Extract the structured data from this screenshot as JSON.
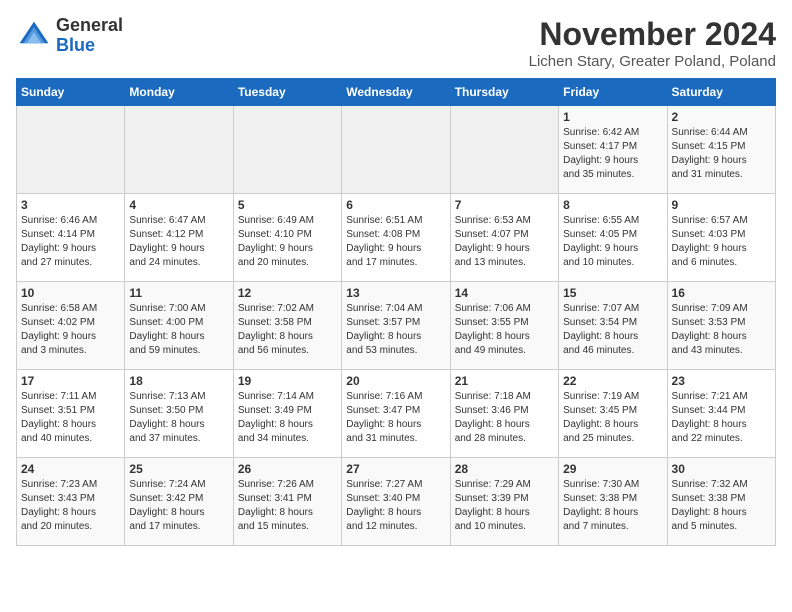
{
  "header": {
    "logo_general": "General",
    "logo_blue": "Blue",
    "title": "November 2024",
    "subtitle": "Lichen Stary, Greater Poland, Poland"
  },
  "weekdays": [
    "Sunday",
    "Monday",
    "Tuesday",
    "Wednesday",
    "Thursday",
    "Friday",
    "Saturday"
  ],
  "weeks": [
    [
      {
        "day": "",
        "info": ""
      },
      {
        "day": "",
        "info": ""
      },
      {
        "day": "",
        "info": ""
      },
      {
        "day": "",
        "info": ""
      },
      {
        "day": "",
        "info": ""
      },
      {
        "day": "1",
        "info": "Sunrise: 6:42 AM\nSunset: 4:17 PM\nDaylight: 9 hours\nand 35 minutes."
      },
      {
        "day": "2",
        "info": "Sunrise: 6:44 AM\nSunset: 4:15 PM\nDaylight: 9 hours\nand 31 minutes."
      }
    ],
    [
      {
        "day": "3",
        "info": "Sunrise: 6:46 AM\nSunset: 4:14 PM\nDaylight: 9 hours\nand 27 minutes."
      },
      {
        "day": "4",
        "info": "Sunrise: 6:47 AM\nSunset: 4:12 PM\nDaylight: 9 hours\nand 24 minutes."
      },
      {
        "day": "5",
        "info": "Sunrise: 6:49 AM\nSunset: 4:10 PM\nDaylight: 9 hours\nand 20 minutes."
      },
      {
        "day": "6",
        "info": "Sunrise: 6:51 AM\nSunset: 4:08 PM\nDaylight: 9 hours\nand 17 minutes."
      },
      {
        "day": "7",
        "info": "Sunrise: 6:53 AM\nSunset: 4:07 PM\nDaylight: 9 hours\nand 13 minutes."
      },
      {
        "day": "8",
        "info": "Sunrise: 6:55 AM\nSunset: 4:05 PM\nDaylight: 9 hours\nand 10 minutes."
      },
      {
        "day": "9",
        "info": "Sunrise: 6:57 AM\nSunset: 4:03 PM\nDaylight: 9 hours\nand 6 minutes."
      }
    ],
    [
      {
        "day": "10",
        "info": "Sunrise: 6:58 AM\nSunset: 4:02 PM\nDaylight: 9 hours\nand 3 minutes."
      },
      {
        "day": "11",
        "info": "Sunrise: 7:00 AM\nSunset: 4:00 PM\nDaylight: 8 hours\nand 59 minutes."
      },
      {
        "day": "12",
        "info": "Sunrise: 7:02 AM\nSunset: 3:58 PM\nDaylight: 8 hours\nand 56 minutes."
      },
      {
        "day": "13",
        "info": "Sunrise: 7:04 AM\nSunset: 3:57 PM\nDaylight: 8 hours\nand 53 minutes."
      },
      {
        "day": "14",
        "info": "Sunrise: 7:06 AM\nSunset: 3:55 PM\nDaylight: 8 hours\nand 49 minutes."
      },
      {
        "day": "15",
        "info": "Sunrise: 7:07 AM\nSunset: 3:54 PM\nDaylight: 8 hours\nand 46 minutes."
      },
      {
        "day": "16",
        "info": "Sunrise: 7:09 AM\nSunset: 3:53 PM\nDaylight: 8 hours\nand 43 minutes."
      }
    ],
    [
      {
        "day": "17",
        "info": "Sunrise: 7:11 AM\nSunset: 3:51 PM\nDaylight: 8 hours\nand 40 minutes."
      },
      {
        "day": "18",
        "info": "Sunrise: 7:13 AM\nSunset: 3:50 PM\nDaylight: 8 hours\nand 37 minutes."
      },
      {
        "day": "19",
        "info": "Sunrise: 7:14 AM\nSunset: 3:49 PM\nDaylight: 8 hours\nand 34 minutes."
      },
      {
        "day": "20",
        "info": "Sunrise: 7:16 AM\nSunset: 3:47 PM\nDaylight: 8 hours\nand 31 minutes."
      },
      {
        "day": "21",
        "info": "Sunrise: 7:18 AM\nSunset: 3:46 PM\nDaylight: 8 hours\nand 28 minutes."
      },
      {
        "day": "22",
        "info": "Sunrise: 7:19 AM\nSunset: 3:45 PM\nDaylight: 8 hours\nand 25 minutes."
      },
      {
        "day": "23",
        "info": "Sunrise: 7:21 AM\nSunset: 3:44 PM\nDaylight: 8 hours\nand 22 minutes."
      }
    ],
    [
      {
        "day": "24",
        "info": "Sunrise: 7:23 AM\nSunset: 3:43 PM\nDaylight: 8 hours\nand 20 minutes."
      },
      {
        "day": "25",
        "info": "Sunrise: 7:24 AM\nSunset: 3:42 PM\nDaylight: 8 hours\nand 17 minutes."
      },
      {
        "day": "26",
        "info": "Sunrise: 7:26 AM\nSunset: 3:41 PM\nDaylight: 8 hours\nand 15 minutes."
      },
      {
        "day": "27",
        "info": "Sunrise: 7:27 AM\nSunset: 3:40 PM\nDaylight: 8 hours\nand 12 minutes."
      },
      {
        "day": "28",
        "info": "Sunrise: 7:29 AM\nSunset: 3:39 PM\nDaylight: 8 hours\nand 10 minutes."
      },
      {
        "day": "29",
        "info": "Sunrise: 7:30 AM\nSunset: 3:38 PM\nDaylight: 8 hours\nand 7 minutes."
      },
      {
        "day": "30",
        "info": "Sunrise: 7:32 AM\nSunset: 3:38 PM\nDaylight: 8 hours\nand 5 minutes."
      }
    ]
  ]
}
